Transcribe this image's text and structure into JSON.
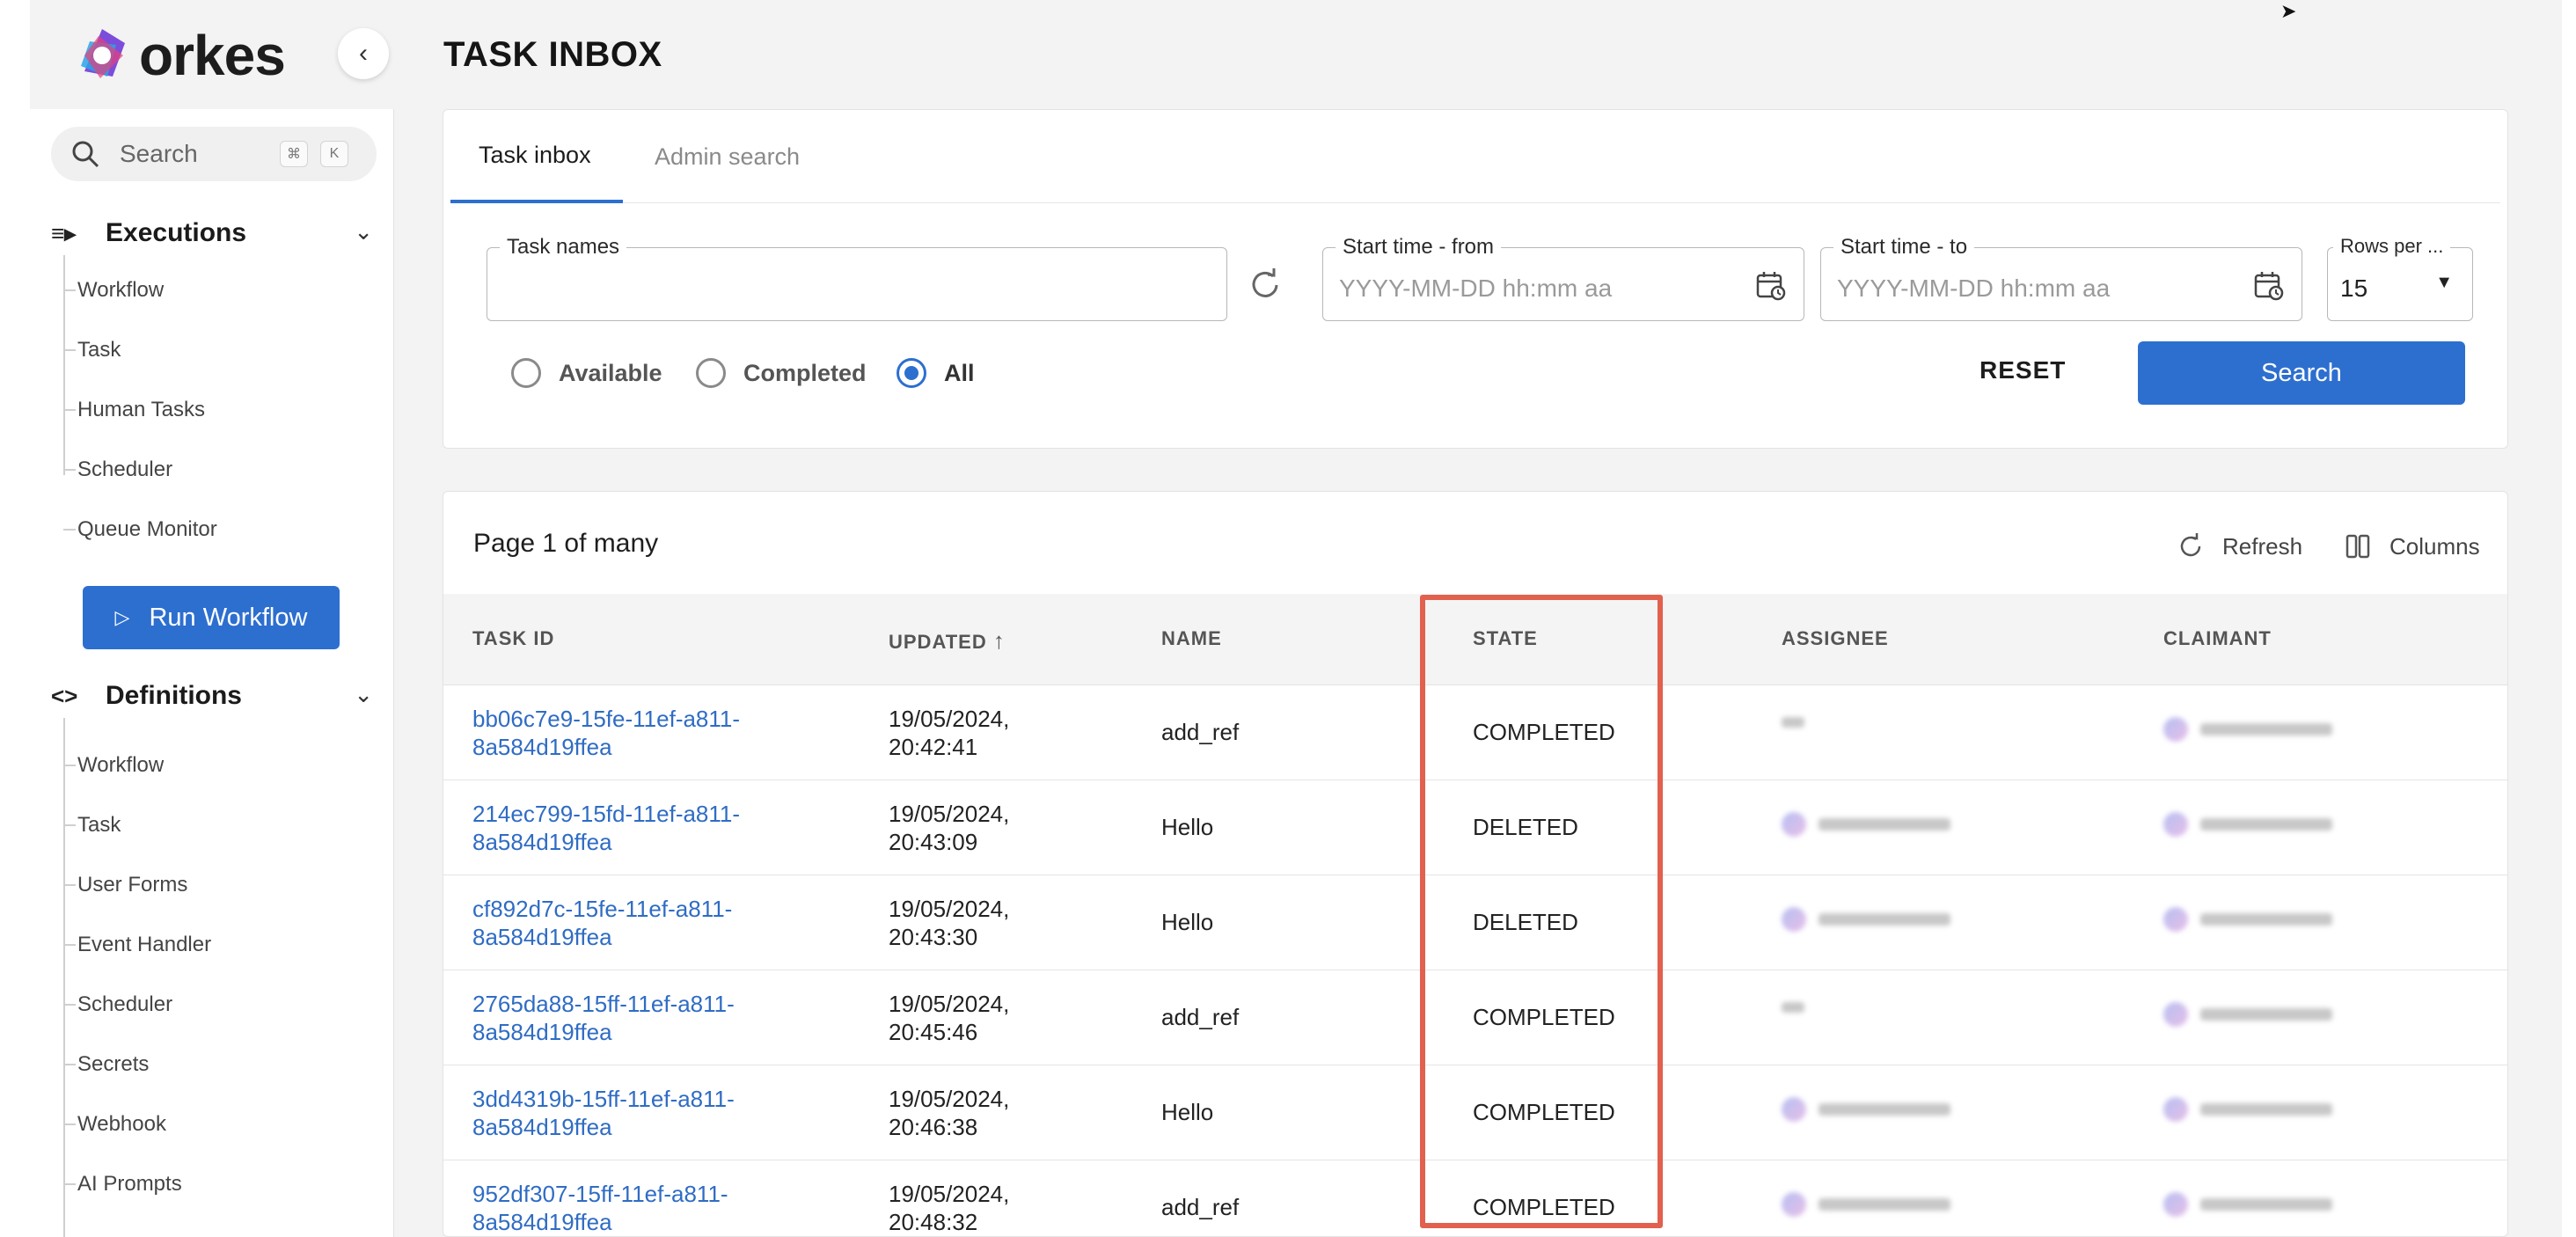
{
  "brand": {
    "name": "orkes"
  },
  "sidebar": {
    "search_placeholder": "Search",
    "shortcut_keys": [
      "⌘",
      "K"
    ],
    "executions": {
      "label": "Executions",
      "items": [
        "Workflow",
        "Task",
        "Human Tasks",
        "Scheduler",
        "Queue Monitor"
      ]
    },
    "run_workflow_label": "Run Workflow",
    "definitions": {
      "label": "Definitions",
      "items": [
        "Workflow",
        "Task",
        "User Forms",
        "Event Handler",
        "Scheduler",
        "Secrets",
        "Webhook",
        "AI Prompts"
      ]
    }
  },
  "page": {
    "title": "TASK INBOX"
  },
  "tabs": [
    {
      "label": "Task inbox",
      "active": true
    },
    {
      "label": "Admin search",
      "active": false
    }
  ],
  "filters": {
    "task_names_label": "Task names",
    "task_names_value": "",
    "start_from_label": "Start time - from",
    "start_from_placeholder": "YYYY-MM-DD hh:mm aa",
    "start_to_label": "Start time - to",
    "start_to_placeholder": "YYYY-MM-DD hh:mm aa",
    "rows_label": "Rows per ...",
    "rows_value": "15",
    "radios": [
      {
        "label": "Available",
        "checked": false
      },
      {
        "label": "Completed",
        "checked": false
      },
      {
        "label": "All",
        "checked": true
      }
    ],
    "reset_label": "RESET",
    "search_label": "Search"
  },
  "results": {
    "page_info": "Page 1 of many",
    "refresh_label": "Refresh",
    "columns_label": "Columns",
    "headers": [
      "TASK ID",
      "UPDATED",
      "NAME",
      "STATE",
      "ASSIGNEE",
      "CLAIMANT"
    ],
    "sort_indicator": "↑",
    "rows": [
      {
        "task_id_1": "bb06c7e9-15fe-11ef-a811-",
        "task_id_2": "8a584d19ffea",
        "updated_1": "19/05/2024,",
        "updated_2": "20:42:41",
        "name": "add_ref",
        "state": "COMPLETED"
      },
      {
        "task_id_1": "214ec799-15fd-11ef-a811-",
        "task_id_2": "8a584d19ffea",
        "updated_1": "19/05/2024,",
        "updated_2": "20:43:09",
        "name": "Hello",
        "state": "DELETED"
      },
      {
        "task_id_1": "cf892d7c-15fe-11ef-a811-",
        "task_id_2": "8a584d19ffea",
        "updated_1": "19/05/2024,",
        "updated_2": "20:43:30",
        "name": "Hello",
        "state": "DELETED"
      },
      {
        "task_id_1": "2765da88-15ff-11ef-a811-",
        "task_id_2": "8a584d19ffea",
        "updated_1": "19/05/2024,",
        "updated_2": "20:45:46",
        "name": "add_ref",
        "state": "COMPLETED"
      },
      {
        "task_id_1": "3dd4319b-15ff-11ef-a811-",
        "task_id_2": "8a584d19ffea",
        "updated_1": "19/05/2024,",
        "updated_2": "20:46:38",
        "name": "Hello",
        "state": "COMPLETED"
      },
      {
        "task_id_1": "952df307-15ff-11ef-a811-",
        "task_id_2": "8a584d19ffea",
        "updated_1": "19/05/2024,",
        "updated_2": "20:48:32",
        "name": "add_ref",
        "state": "COMPLETED"
      }
    ]
  },
  "colors": {
    "accent": "#2d6fcf",
    "link": "#2f6cc4",
    "highlight": "#e2604e"
  }
}
